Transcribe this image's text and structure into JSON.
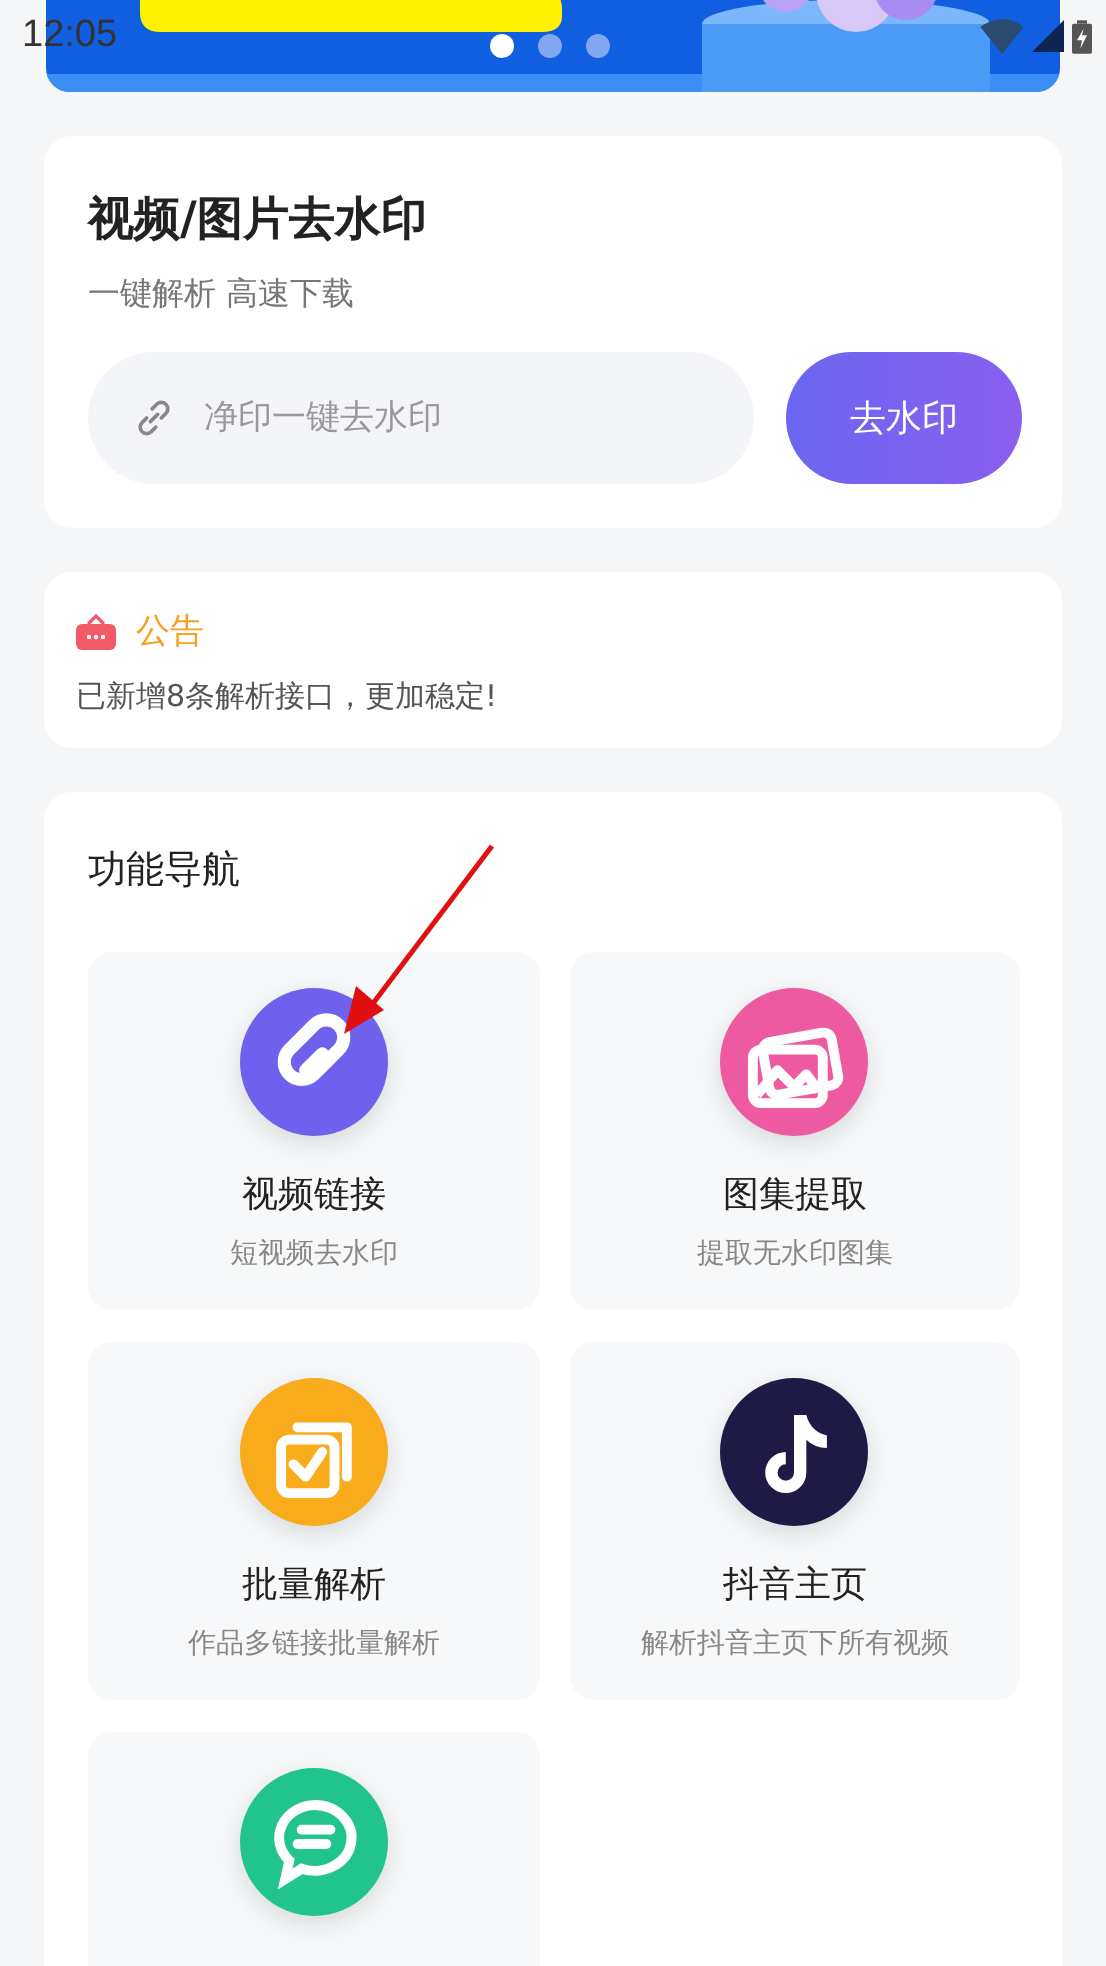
{
  "status_bar": {
    "time": "12:05"
  },
  "banner": {
    "dots": [
      {
        "selected": true
      },
      {
        "selected": false
      },
      {
        "selected": false
      }
    ]
  },
  "watermark_card": {
    "title": "视频/图片去水印",
    "subtitle": "一键解析 高速下载",
    "input": {
      "placeholder": "净印一键去水印"
    },
    "button": "去水印"
  },
  "notice": {
    "title": "公告",
    "text": "已新增8条解析接口，更加稳定!"
  },
  "nav": {
    "title": "功能导航",
    "tiles": [
      {
        "kind": "link",
        "color": "#7060ee",
        "title": "视频链接",
        "subtitle": "短视频去水印"
      },
      {
        "kind": "gallery",
        "color": "#ee5aa0",
        "title": "图集提取",
        "subtitle": "提取无水印图集"
      },
      {
        "kind": "batch",
        "color": "#f8ac1c",
        "title": "批量解析",
        "subtitle": "作品多链接批量解析"
      },
      {
        "kind": "music",
        "color": "#1f1a45",
        "title": "抖音主页",
        "subtitle": "解析抖音主页下所有视频"
      },
      {
        "kind": "chat",
        "color": "#20c48c"
      }
    ]
  },
  "annotation": {
    "kind": "arrow"
  }
}
